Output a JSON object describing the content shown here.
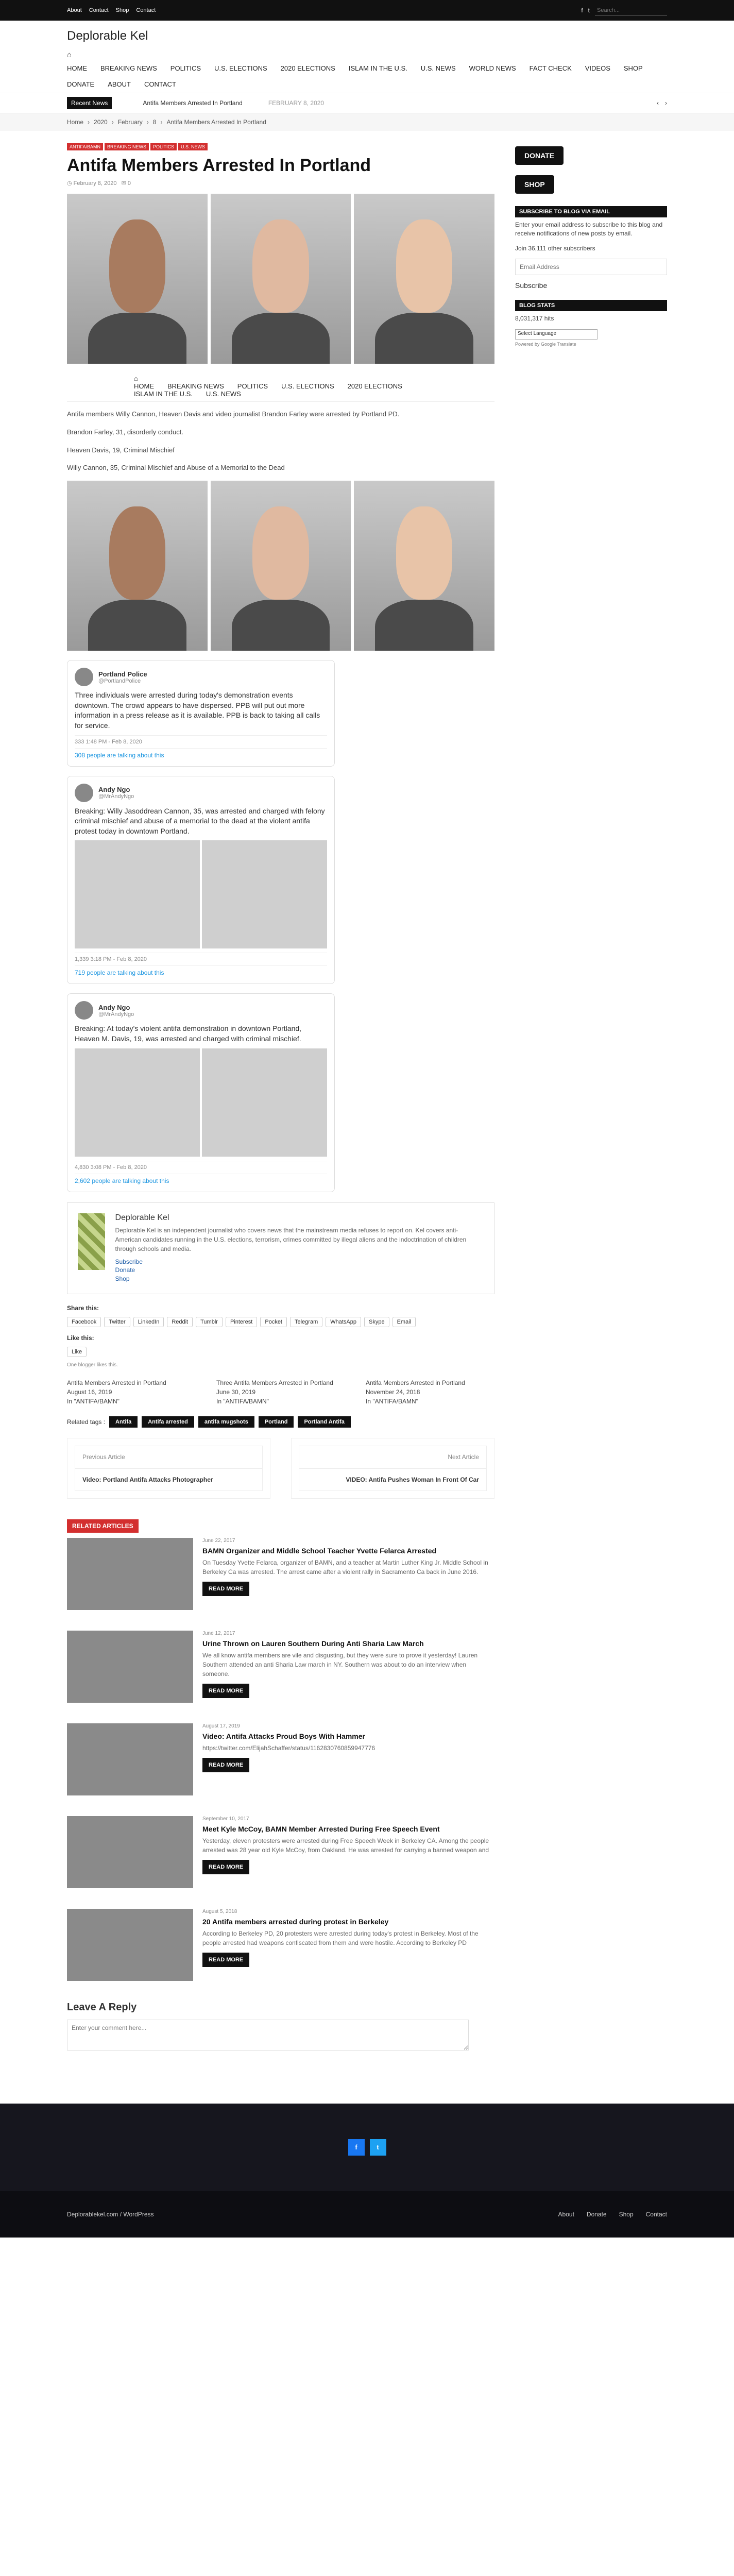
{
  "topbar": {
    "links": [
      "About",
      "Contact",
      "Shop",
      "Contact"
    ],
    "search_placeholder": "Search..."
  },
  "site": {
    "title": "Deplorable Kel"
  },
  "nav": [
    "Home",
    "Breaking News",
    "Politics",
    "U.S. Elections",
    "2020 Elections",
    "Islam in the U.S.",
    "U.S. News",
    "World News",
    "Fact Check",
    "Videos",
    "Shop",
    "Donate",
    "About",
    "Contact"
  ],
  "ticker": {
    "label": "Recent News",
    "headline": "Antifa Members Arrested In Portland",
    "date": "FEBRUARY 8, 2020"
  },
  "breadcrumb": [
    "Home",
    "2020",
    "February",
    "8",
    "Antifa Members Arrested In Portland"
  ],
  "post": {
    "categories": [
      "Antifa/BAMN",
      "Breaking News",
      "Politics",
      "U.S. News"
    ],
    "title": "Antifa Members Arrested In Portland",
    "date": "February 8, 2020",
    "comments": "0",
    "paras": [
      "Antifa members Willy Cannon, Heaven Davis and video journalist Brandon Farley were arrested by Portland PD.",
      "Brandon Farley, 31, disorderly conduct.",
      "Heaven Davis, 19, Criminal Mischief",
      "Willy Cannon, 35, Criminal Mischief and Abuse of a Memorial to the Dead"
    ]
  },
  "tweets": [
    {
      "name": "Portland Police",
      "handle": "@PortlandPolice",
      "text": "Three individuals were arrested during today's demonstration events downtown. The crowd appears to have dispersed. PPB will put out more information in a press release as it is available. PPB is back to taking all calls for service.",
      "stats": "333   1:48 PM - Feb 8, 2020",
      "talk": "308 people are talking about this"
    },
    {
      "name": "Andy Ngo",
      "handle": "@MrAndyNgo",
      "text": "Breaking: Willy Jasoddrean Cannon, 35, was arrested and charged with felony criminal mischief and abuse of a memorial to the dead at the violent antifa protest today in downtown Portland.",
      "stats": "1,339   3:18 PM - Feb 8, 2020",
      "talk": "719 people are talking about this"
    },
    {
      "name": "Andy Ngo",
      "handle": "@MrAndyNgo",
      "text": "Breaking: At today's violent antifa demonstration in downtown Portland, Heaven M. Davis, 19, was arrested and charged with criminal mischief.",
      "stats": "4,830   3:08 PM - Feb 8, 2020",
      "talk": "2,602 people are talking about this"
    }
  ],
  "author": {
    "name": "Deplorable Kel",
    "bio": "Deplorable Kel is an independent journalist who covers news that the mainstream media refuses to report on. Kel covers anti-American candidates running in the U.S. elections, terrorism, crimes committed by illegal aliens and the indoctrination of children through schools and media.",
    "links": [
      "Subscribe",
      "Donate",
      "Shop"
    ]
  },
  "share": {
    "label": "Share this:",
    "buttons": [
      "Facebook",
      "Twitter",
      "LinkedIn",
      "Reddit",
      "Tumblr",
      "Pinterest",
      "Pocket",
      "Telegram",
      "WhatsApp",
      "Skype",
      "Email"
    ],
    "like_label": "Like this:",
    "like_btn": "Like",
    "like_note": "One blogger likes this."
  },
  "related_small": [
    {
      "title": "Antifa Members Arrested in Portland",
      "date": "August 16, 2019",
      "cat": "In \"ANTIFA/BAMN\""
    },
    {
      "title": "Three Antifa Members Arrested in Portland",
      "date": "June 30, 2019",
      "cat": "In \"ANTIFA/BAMN\""
    },
    {
      "title": "Antifa Members Arrested in Portland",
      "date": "November 24, 2018",
      "cat": "In \"ANTIFA/BAMN\""
    }
  ],
  "tags": {
    "label": "Related tags :",
    "items": [
      "Antifa",
      "Antifa arrested",
      "antifa mugshots",
      "Portland",
      "Portland Antifa"
    ]
  },
  "prevnext": {
    "prev_label": "Previous Article",
    "prev": "Video: Portland Antifa Attacks Photographer",
    "next_label": "Next Article",
    "next": "VIDEO: Antifa Pushes Woman In Front Of Car"
  },
  "related": {
    "title": "RELATED ARTICLES",
    "items": [
      {
        "date": "June 22, 2017",
        "title": "BAMN Organizer and Middle School Teacher Yvette Felarca Arrested",
        "excerpt": "On Tuesday Yvette Felarca, organizer of BAMN, and a teacher at Martin Luther King Jr. Middle School in Berkeley Ca was arrested. The arrest came after a violent rally in Sacramento Ca back in June 2016."
      },
      {
        "date": "June 12, 2017",
        "title": "Urine Thrown on Lauren Southern During Anti Sharia Law March",
        "excerpt": "We all know antifa members are vile and disgusting, but they were sure to prove it yesterday! Lauren Southern attended an anti Sharia Law march in NY. Southern was about to do an interview when someone."
      },
      {
        "date": "August 17, 2019",
        "title": "Video: Antifa Attacks Proud Boys With Hammer",
        "excerpt": "https://twitter.com/ElijahSchaffer/status/1162830760859947776"
      },
      {
        "date": "September 10, 2017",
        "title": "Meet Kyle McCoy, BAMN Member Arrested During Free Speech Event",
        "excerpt": "Yesterday, eleven protesters were arrested during Free Speech Week in Berkeley CA. Among the people arrested was 28 year old Kyle McCoy, from Oakland. He was arrested for carrying a banned weapon and"
      },
      {
        "date": "August 5, 2018",
        "title": "20 Antifa members arrested during protest in Berkeley",
        "excerpt": "According to Berkeley PD, 20 protesters were arrested during today's protest in Berkeley. Most of the people arrested had weapons confiscated from them and were hostile. According to Berkeley PD"
      }
    ],
    "read_more": "READ MORE"
  },
  "reply": {
    "title": "Leave A Reply",
    "placeholder": "Enter your comment here..."
  },
  "sidebar": {
    "donate": "DONATE",
    "shop": "SHOP",
    "sub_title": "SUBSCRIBE TO BLOG VIA EMAIL",
    "sub_text": "Enter your email address to subscribe to this blog and receive notifications of new posts by email.",
    "join": "Join 36,111 other subscribers",
    "email_placeholder": "Email Address",
    "subscribe": "Subscribe",
    "stats_title": "BLOG STATS",
    "hits": "8,031,317 hits",
    "lang": "Select Language",
    "gt": "Powered by Google Translate"
  },
  "footer": {
    "site": "Deplorablekel.com / WordPress",
    "links": [
      "About",
      "Donate",
      "Shop",
      "Contact"
    ]
  }
}
